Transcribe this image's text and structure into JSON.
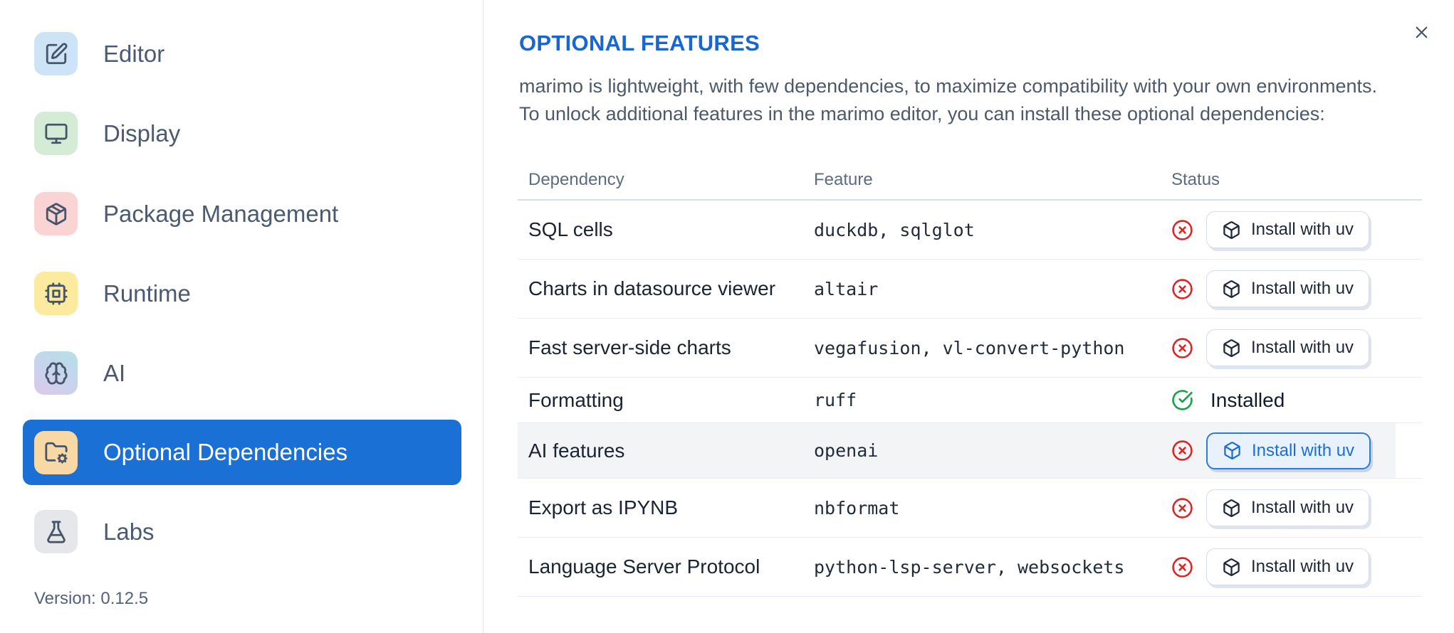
{
  "sidebar": {
    "items": [
      {
        "label": "Editor",
        "icon": "square-pen",
        "icon_bg": "#cde4f7"
      },
      {
        "label": "Display",
        "icon": "monitor",
        "icon_bg": "#d4ecd5"
      },
      {
        "label": "Package Management",
        "icon": "package",
        "icon_bg": "#fad3d4"
      },
      {
        "label": "Runtime",
        "icon": "cpu",
        "icon_bg": "#fcea9f"
      },
      {
        "label": "AI",
        "icon": "brain",
        "icon_bg": "linear-gradient(210deg,#b5e0e5 0%,#c9d3ee 55%,#dcc9e8 100%)"
      },
      {
        "label": "Optional Dependencies",
        "icon": "folder-cog",
        "icon_bg": "#f8d9a6",
        "selected": true
      },
      {
        "label": "Labs",
        "icon": "flask",
        "icon_bg": "#e6e7eb"
      }
    ],
    "version": "Version: 0.12.5"
  },
  "main": {
    "title": "OPTIONAL FEATURES",
    "description_line1": "marimo is lightweight, with few dependencies, to maximize compatibility with your own environments.",
    "description_line2": "To unlock additional features in the marimo editor, you can install these optional dependencies:",
    "table": {
      "columns": [
        "Dependency",
        "Feature",
        "Status"
      ],
      "install_button_label": "Install with uv",
      "installed_label": "Installed",
      "rows": [
        {
          "dependency": "SQL cells",
          "feature": "duckdb, sqlglot",
          "installed": false,
          "button": "Install with uv"
        },
        {
          "dependency": "Charts in datasource viewer",
          "feature": "altair",
          "installed": false,
          "button": "Install with uv"
        },
        {
          "dependency": "Fast server-side charts",
          "feature": "vegafusion, vl-convert-python",
          "installed": false,
          "button": "Install with uv"
        },
        {
          "dependency": "Formatting",
          "feature": "ruff",
          "installed": true,
          "status_label": "Installed"
        },
        {
          "dependency": "AI features",
          "feature": "openai",
          "installed": false,
          "button": "Install with uv",
          "highlighted": true
        },
        {
          "dependency": "Export as IPYNB",
          "feature": "nbformat",
          "installed": false,
          "button": "Install with uv"
        },
        {
          "dependency": "Language Server Protocol",
          "feature": "python-lsp-server, websockets",
          "installed": false,
          "button": "Install with uv"
        }
      ]
    }
  },
  "colors": {
    "accent_blue": "#1b70d6",
    "title_blue": "#1a66d1",
    "error_red": "#dc2626",
    "success_green": "#16a34a",
    "row_highlight": "#f3f4f6"
  }
}
